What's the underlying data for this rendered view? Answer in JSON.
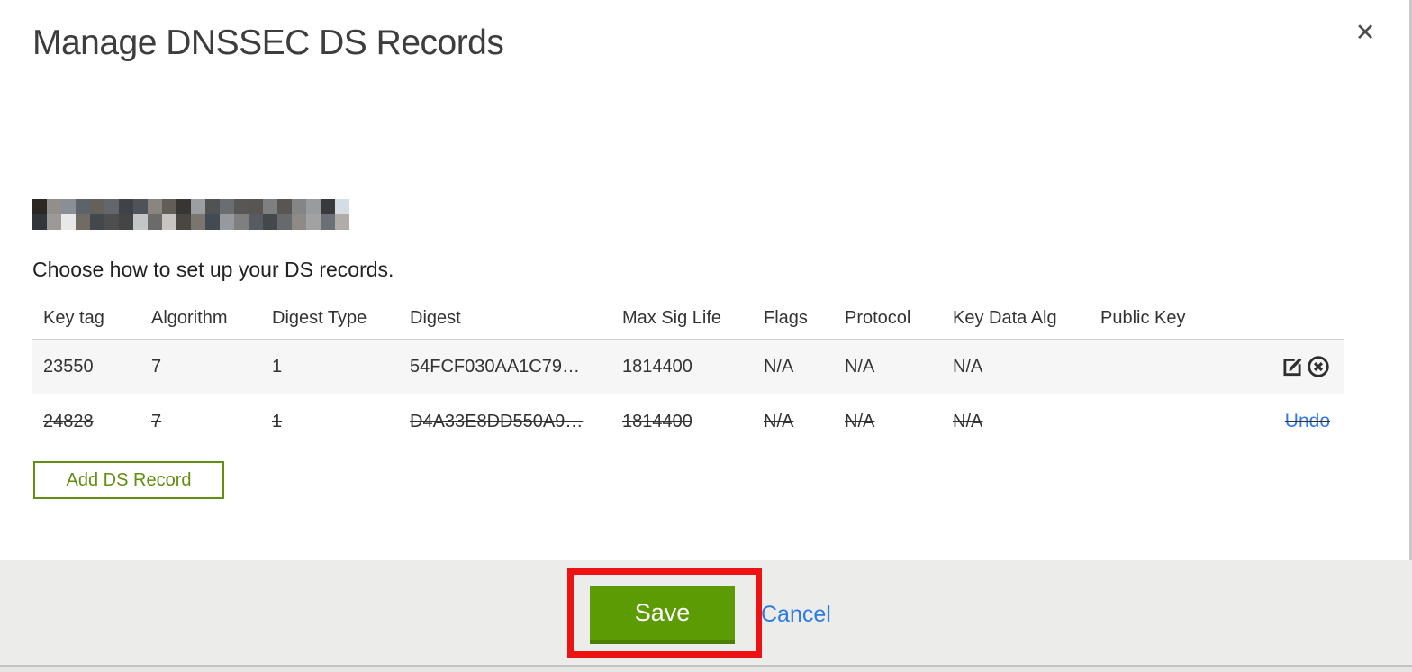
{
  "modal": {
    "title": "Manage DNSSEC DS Records",
    "close_label": "✕",
    "instruction": "Choose how to set up your DS records."
  },
  "table": {
    "columns": [
      "Key tag",
      "Algorithm",
      "Digest Type",
      "Digest",
      "Max Sig Life",
      "Flags",
      "Protocol",
      "Key Data Alg",
      "Public Key"
    ],
    "rows": [
      {
        "key_tag": "23550",
        "algorithm": "7",
        "digest_type": "1",
        "digest": "54FCF030AA1C79…",
        "max_sig_life": "1814400",
        "flags": "N/A",
        "protocol": "N/A",
        "key_data_alg": "N/A",
        "public_key": "",
        "state": "active"
      },
      {
        "key_tag": "24828",
        "algorithm": "7",
        "digest_type": "1",
        "digest": "D4A33E8DD550A9…",
        "max_sig_life": "1814400",
        "flags": "N/A",
        "protocol": "N/A",
        "key_data_alg": "N/A",
        "public_key": "",
        "state": "deleted",
        "undo_label": "Undo"
      }
    ]
  },
  "buttons": {
    "add_ds_record": "Add DS Record",
    "save": "Save",
    "cancel": "Cancel"
  },
  "colors": {
    "save_green": "#5d9b04",
    "save_green_dark": "#4d7f06",
    "outline_green": "#628e11",
    "link_blue": "#3379ec",
    "annotation_red": "#ee1313",
    "row_highlight": "#f6f6f6",
    "footer_gray": "#ececeb"
  }
}
